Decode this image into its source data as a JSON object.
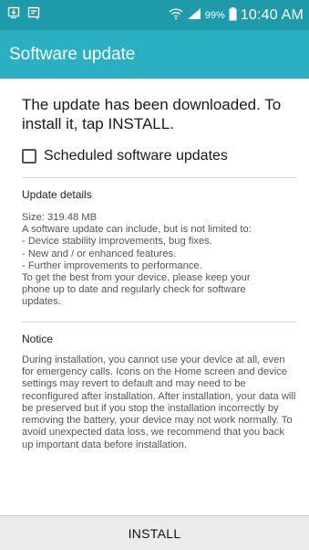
{
  "status_bar": {
    "left_icons": [
      "download-icon",
      "message-icon"
    ],
    "right_icons": [
      "wifi-icon",
      "signal-icon",
      "battery-icon"
    ],
    "battery_percent": "99%",
    "time": "10:40 AM",
    "background_color": "#1e9aab"
  },
  "app_bar": {
    "title": "Software update",
    "background_color": "#2ab0c2"
  },
  "main": {
    "headline": "The update has been downloaded. To install it, tap INSTALL.",
    "scheduled_checkbox": {
      "label": "Scheduled software updates",
      "checked": false
    },
    "update_details": {
      "title": "Update details",
      "lines": [
        "Size: 319.48 MB",
        "A software update can include, but is not limited to:",
        " - Device stability improvements, bug fixes.",
        " - New and / or enhanced features.",
        " - Further improvements to performance.",
        "To get the best from your device, please keep your",
        "phone up to date and regularly check for software",
        "updates."
      ]
    },
    "notice": {
      "title": "Notice",
      "text": "During installation, you cannot use your device at all, even for emergency calls. Icons on the Home screen and device settings may revert to default and may need to be reconfigured after installation. After installation, your data will be preserved but if you stop the installation incorrectly by removing the battery, your device may not work normally. To avoid unexpected data loss, we recommend that you back up important data before installation."
    }
  },
  "footer": {
    "install_label": "INSTALL"
  }
}
